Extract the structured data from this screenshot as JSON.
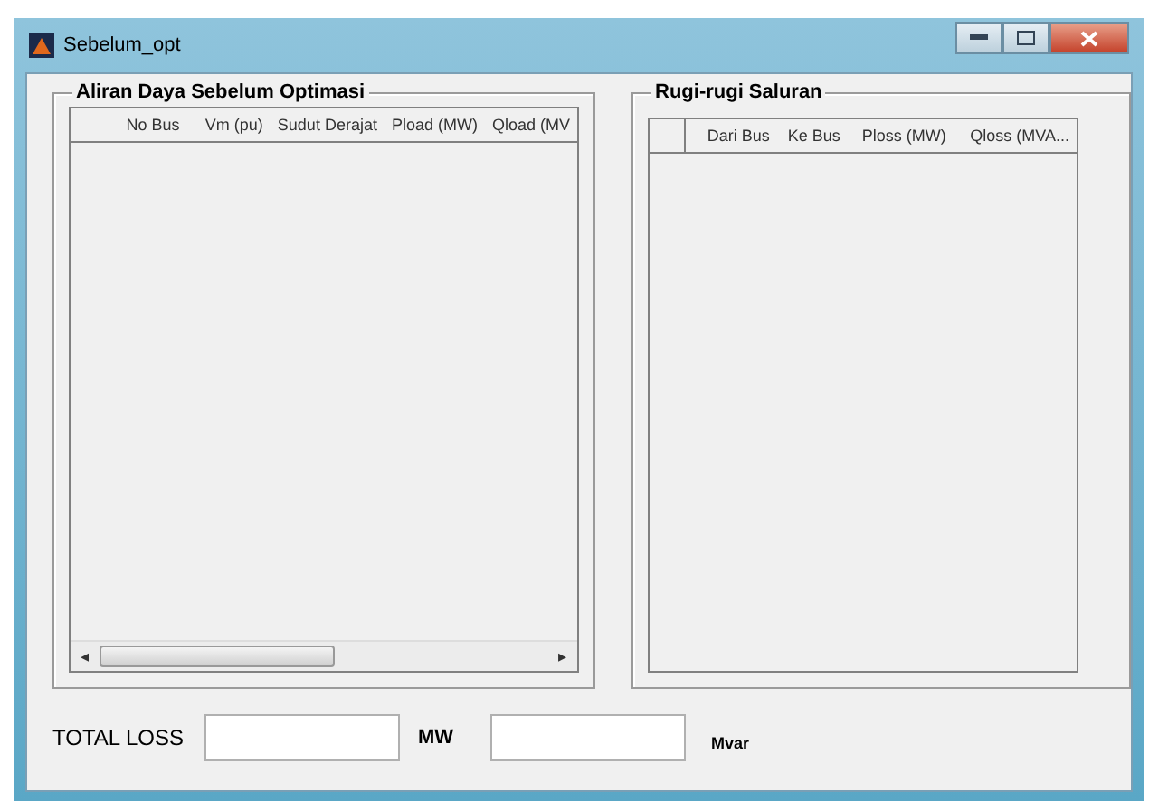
{
  "window": {
    "title": "Sebelum_opt"
  },
  "left_panel": {
    "title": "Aliran Daya Sebelum Optimasi",
    "columns": [
      "No Bus",
      "Vm (pu)",
      "Sudut Derajat",
      "Pload (MW)",
      "Qload (MV"
    ],
    "scrollbar_arrows": [
      "◂",
      "▸"
    ]
  },
  "right_panel": {
    "title": "Rugi-rugi Saluran",
    "columns": [
      "Dari Bus",
      "Ke Bus",
      "Ploss (MW)",
      "Qloss (MVA..."
    ]
  },
  "totals": {
    "label": "TOTAL LOSS",
    "unit_1": "MW",
    "unit_2": "Mvar"
  }
}
